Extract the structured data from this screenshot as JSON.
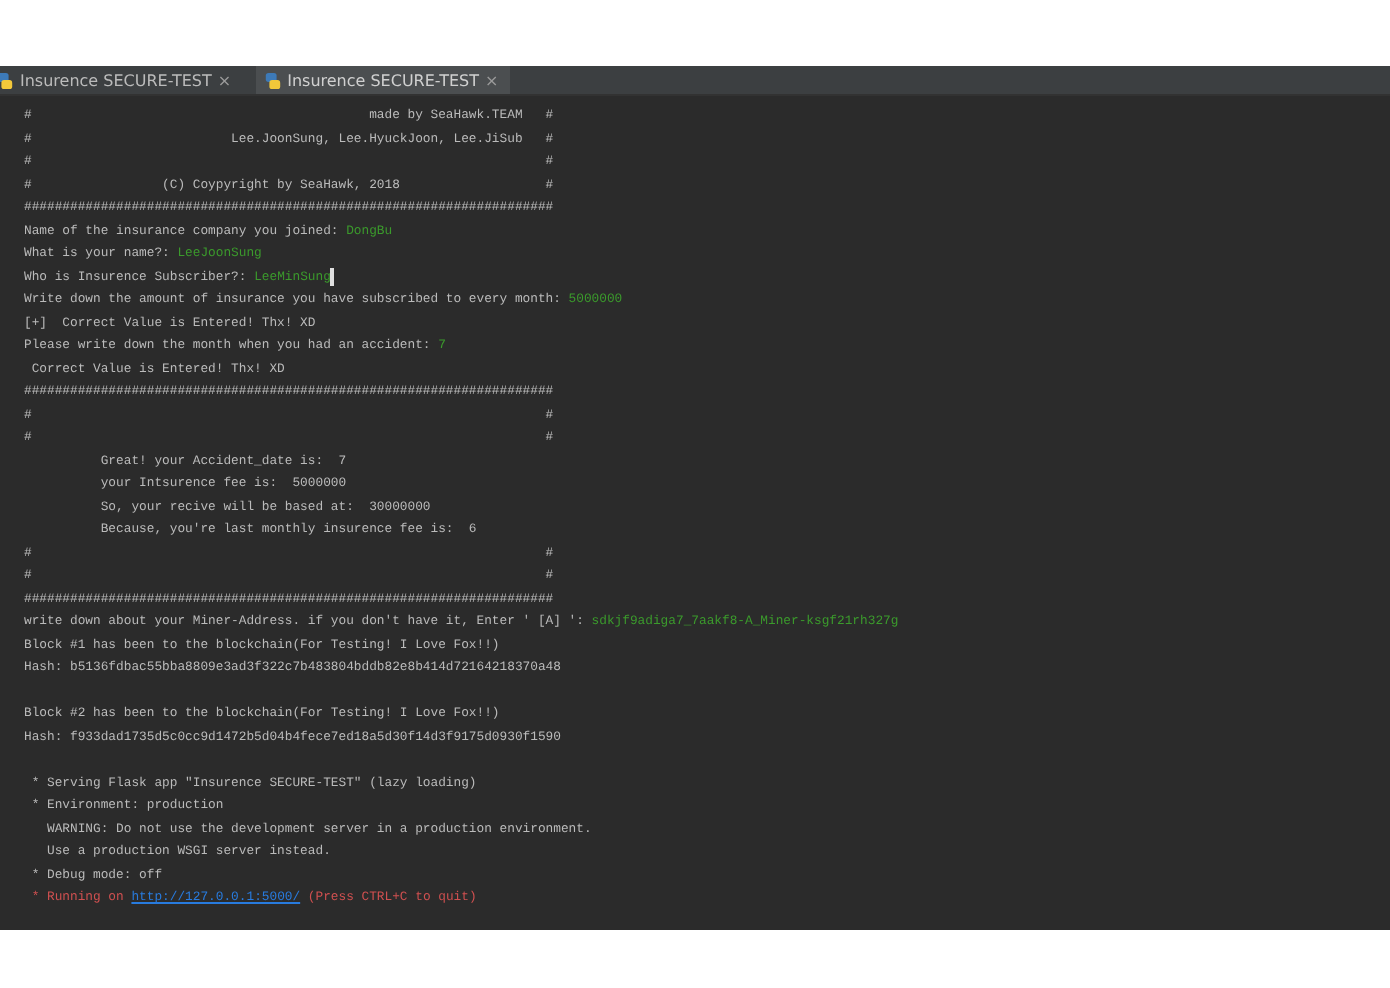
{
  "tabs": [
    {
      "label": "Insurence SECURE-TEST",
      "close": "×",
      "selected": false
    },
    {
      "label": "Insurence SECURE-TEST",
      "close": "×",
      "selected": true
    }
  ],
  "console": {
    "lines": [
      {
        "kind": "text",
        "segments": [
          {
            "kind": "output",
            "text": "#                                            made by SeaHawk.TEAM   #"
          }
        ]
      },
      {
        "kind": "text",
        "segments": [
          {
            "kind": "output",
            "text": "#                          Lee.JoonSung, Lee.HyuckJoon, Lee.JiSub   #"
          }
        ]
      },
      {
        "kind": "text",
        "segments": [
          {
            "kind": "output",
            "text": "#                                                                   #"
          }
        ]
      },
      {
        "kind": "text",
        "segments": [
          {
            "kind": "output",
            "text": "#                 (C) Coypyright by SeaHawk, 2018                   #"
          }
        ]
      },
      {
        "kind": "text",
        "segments": [
          {
            "kind": "output",
            "text": "#####################################################################"
          }
        ]
      },
      {
        "kind": "text",
        "segments": [
          {
            "kind": "output",
            "text": "Name of the insurance company you joined: "
          },
          {
            "kind": "input",
            "text": "DongBu"
          }
        ]
      },
      {
        "kind": "text",
        "segments": [
          {
            "kind": "output",
            "text": "What is your name?: "
          },
          {
            "kind": "input",
            "text": "LeeJoonSung"
          }
        ]
      },
      {
        "kind": "text",
        "cursor": true,
        "segments": [
          {
            "kind": "output",
            "text": "Who is Insurence Subscriber?: "
          },
          {
            "kind": "input",
            "text": "LeeMinSung"
          }
        ]
      },
      {
        "kind": "text",
        "segments": [
          {
            "kind": "output",
            "text": "Write down the amount of insurance you have subscribed to every month: "
          },
          {
            "kind": "input",
            "text": "5000000"
          }
        ]
      },
      {
        "kind": "text",
        "segments": [
          {
            "kind": "output",
            "text": "[+]  Correct Value is Entered! Thx! XD"
          }
        ]
      },
      {
        "kind": "text",
        "segments": [
          {
            "kind": "output",
            "text": "Please write down the month when you had an accident: "
          },
          {
            "kind": "input",
            "text": "7"
          }
        ]
      },
      {
        "kind": "text",
        "segments": [
          {
            "kind": "output",
            "text": " Correct Value is Entered! Thx! XD"
          }
        ]
      },
      {
        "kind": "text",
        "segments": [
          {
            "kind": "output",
            "text": "#####################################################################"
          }
        ]
      },
      {
        "kind": "text",
        "segments": [
          {
            "kind": "output",
            "text": "#                                                                   #"
          }
        ]
      },
      {
        "kind": "text",
        "segments": [
          {
            "kind": "output",
            "text": "#                                                                   #"
          }
        ]
      },
      {
        "kind": "text",
        "segments": [
          {
            "kind": "output",
            "text": "          Great! your Accident_date is:  7"
          }
        ]
      },
      {
        "kind": "text",
        "segments": [
          {
            "kind": "output",
            "text": "          your Intsurence fee is:  5000000"
          }
        ]
      },
      {
        "kind": "text",
        "segments": [
          {
            "kind": "output",
            "text": "          So, your recive will be based at:  30000000"
          }
        ]
      },
      {
        "kind": "text",
        "segments": [
          {
            "kind": "output",
            "text": "          Because, you're last monthly insurence fee is:  6"
          }
        ]
      },
      {
        "kind": "text",
        "segments": [
          {
            "kind": "output",
            "text": "#                                                                   #"
          }
        ]
      },
      {
        "kind": "text",
        "segments": [
          {
            "kind": "output",
            "text": "#                                                                   #"
          }
        ]
      },
      {
        "kind": "text",
        "segments": [
          {
            "kind": "output",
            "text": "#####################################################################"
          }
        ]
      },
      {
        "kind": "text",
        "segments": [
          {
            "kind": "output",
            "text": "write down about your Miner-Address. if you don't have it, Enter ' [A] ': "
          },
          {
            "kind": "input",
            "text": "sdkjf9adiga7_7aakf8-A_Miner-ksgf21rh327g"
          }
        ]
      },
      {
        "kind": "text",
        "segments": [
          {
            "kind": "output",
            "text": "Block #1 has been to the blockchain(For Testing! I Love Fox!!)"
          }
        ]
      },
      {
        "kind": "text",
        "segments": [
          {
            "kind": "output",
            "text": "Hash: b5136fdbac55bba8809e3ad3f322c7b483804bddb82e8b414d72164218370a48"
          }
        ]
      },
      {
        "kind": "blank"
      },
      {
        "kind": "text",
        "segments": [
          {
            "kind": "output",
            "text": "Block #2 has been to the blockchain(For Testing! I Love Fox!!)"
          }
        ]
      },
      {
        "kind": "text",
        "segments": [
          {
            "kind": "output",
            "text": "Hash: f933dad1735d5c0cc9d1472b5d04b4fece7ed18a5d30f14d3f9175d0930f1590"
          }
        ]
      },
      {
        "kind": "blank"
      },
      {
        "kind": "text",
        "segments": [
          {
            "kind": "output",
            "text": " * Serving Flask app \"Insurence SECURE-TEST\" (lazy loading)"
          }
        ]
      },
      {
        "kind": "text",
        "segments": [
          {
            "kind": "output",
            "text": " * Environment: production"
          }
        ]
      },
      {
        "kind": "text",
        "segments": [
          {
            "kind": "output",
            "text": "   WARNING: Do not use the development server in a production environment."
          }
        ]
      },
      {
        "kind": "text",
        "segments": [
          {
            "kind": "output",
            "text": "   Use a production WSGI server instead."
          }
        ]
      },
      {
        "kind": "text",
        "segments": [
          {
            "kind": "output",
            "text": " * Debug mode: off"
          }
        ]
      },
      {
        "kind": "text",
        "segments": [
          {
            "kind": "error",
            "text": " * Running on "
          },
          {
            "kind": "link",
            "text": "http://127.0.0.1:5000/"
          },
          {
            "kind": "error",
            "text": " (Press CTRL+C to quit)"
          }
        ]
      }
    ]
  }
}
